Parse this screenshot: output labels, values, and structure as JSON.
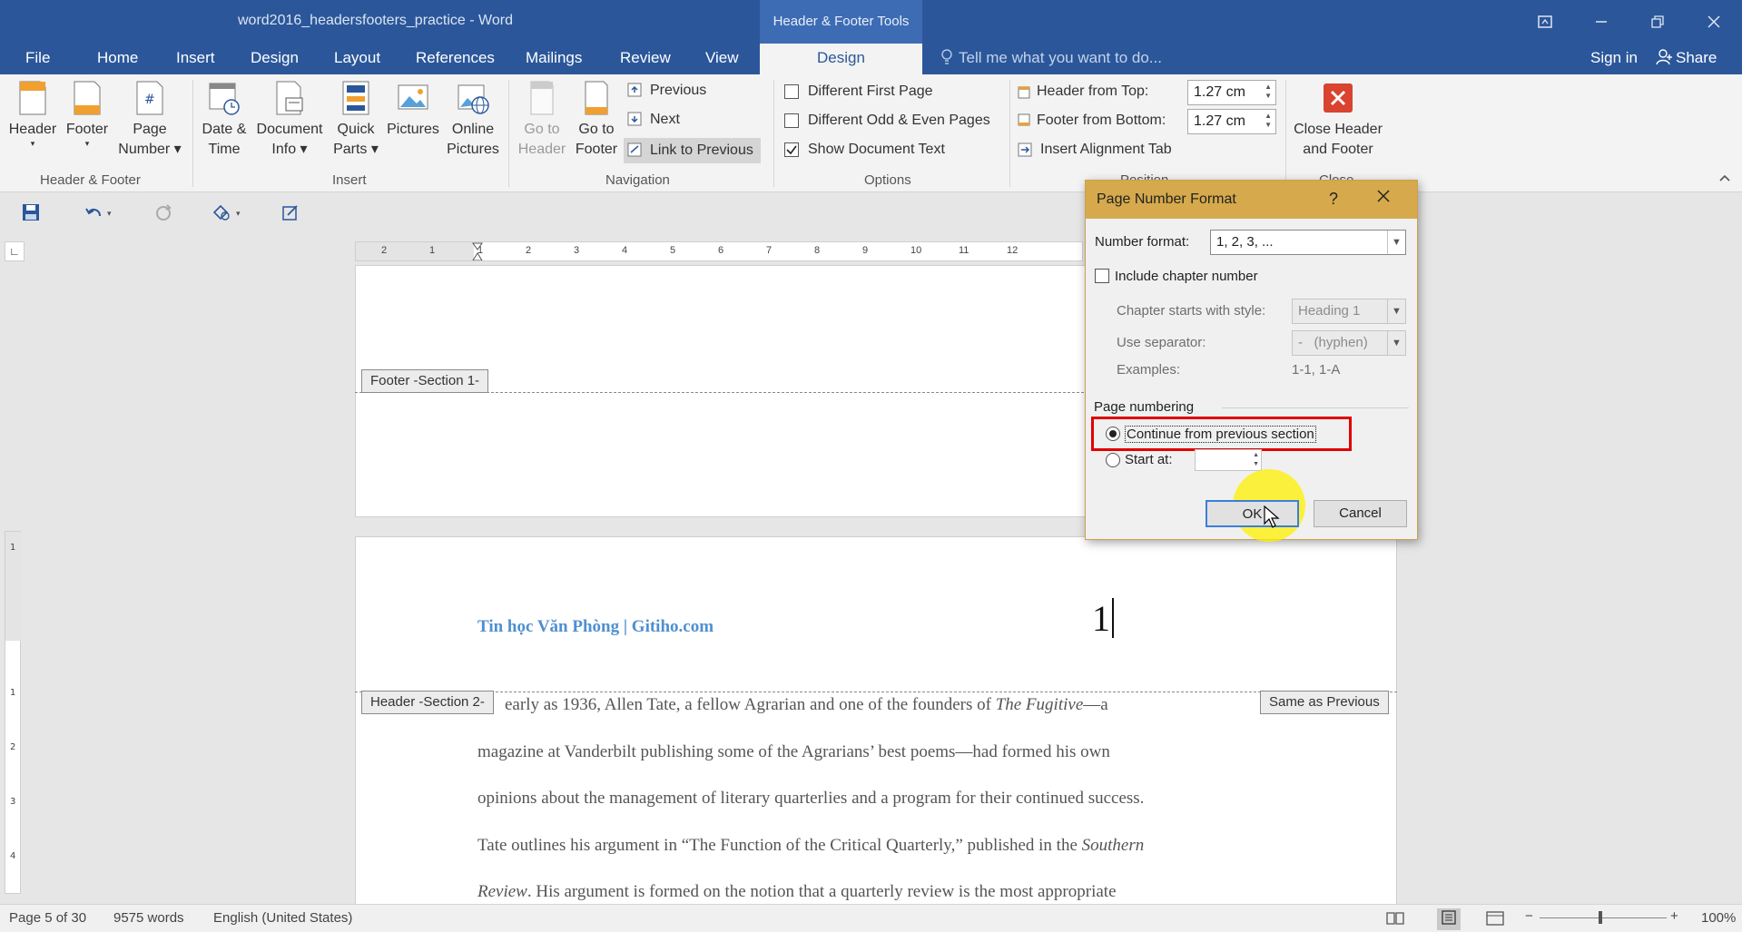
{
  "titlebar": {
    "doc_title": "word2016_headersfooters_practice - Word",
    "tools_context": "Header & Footer Tools"
  },
  "tabs": {
    "file": "File",
    "home": "Home",
    "insert": "Insert",
    "design": "Design",
    "layout": "Layout",
    "references": "References",
    "mailings": "Mailings",
    "review": "Review",
    "view": "View",
    "design_active": "Design",
    "tellme": "Tell me what you want to do...",
    "signin": "Sign in",
    "share": "Share"
  },
  "ribbon": {
    "header_btn": "Header",
    "footer_btn": "Footer",
    "page_number_l1": "Page",
    "page_number_l2": "Number",
    "group_header_footer": "Header & Footer",
    "date_time_l1": "Date &",
    "date_time_l2": "Time",
    "doc_info_l1": "Document",
    "doc_info_l2": "Info",
    "quick_parts_l1": "Quick",
    "quick_parts_l2": "Parts",
    "pictures": "Pictures",
    "online_pictures_l1": "Online",
    "online_pictures_l2": "Pictures",
    "group_insert": "Insert",
    "goto_header_l1": "Go to",
    "goto_header_l2": "Header",
    "goto_footer_l1": "Go to",
    "goto_footer_l2": "Footer",
    "previous": "Previous",
    "next": "Next",
    "link_to_previous": "Link to Previous",
    "group_navigation": "Navigation",
    "diff_first_page": "Different First Page",
    "diff_odd_even": "Different Odd & Even Pages",
    "show_doc_text": "Show Document Text",
    "group_options": "Options",
    "header_from_top": "Header from Top:",
    "footer_from_bottom": "Footer from Bottom:",
    "header_from_top_val": "1.27 cm",
    "footer_from_bottom_val": "1.27 cm",
    "insert_alignment_tab": "Insert Alignment Tab",
    "group_position": "Position",
    "close_l1": "Close Header",
    "close_l2": "and Footer",
    "group_close": "Close"
  },
  "ruler": {
    "ticks": [
      "2",
      "1",
      "1",
      "2",
      "3",
      "4",
      "5",
      "6",
      "7",
      "8",
      "9",
      "10",
      "11",
      "12"
    ]
  },
  "document": {
    "footer_tag": "Footer -Section 1-",
    "header_tag": "Header -Section 2-",
    "same_as_previous": "Same as Previous",
    "header_brand": "Tin học Văn Phòng | Gitiho.com",
    "page_num": "1",
    "line1a": "early as 1936, Allen Tate, a fellow Agrarian and one of the founders of ",
    "line1b": "The Fugitive",
    "line1c": "—a",
    "line2": "magazine at Vanderbilt publishing some of the Agrarians’ best poems—had formed his own",
    "line3": "opinions about the management of literary quarterlies and a program for their continued success.",
    "line4a": "Tate outlines his argument in “The Function of the Critical Quarterly,” published in the ",
    "line4b": "Southern",
    "line5a": "Review",
    "line5b": ". His argument is formed on the notion that a quarterly review is the most appropriate"
  },
  "dialog": {
    "title": "Page Number Format",
    "help": "?",
    "number_format_label": "Number format:",
    "number_format_value": "1, 2, 3, ...",
    "include_chapter": "Include chapter number",
    "chapter_style_label": "Chapter starts with style:",
    "chapter_style_value": "Heading 1",
    "separator_label": "Use separator:",
    "separator_value": "-   (hyphen)",
    "examples_label": "Examples:",
    "examples_value": "1-1, 1-A",
    "page_numbering_label": "Page numbering",
    "continue_label": "Continue from previous section",
    "start_at_label": "Start at:",
    "ok": "OK",
    "cancel": "Cancel",
    "highlight_color": "#e00000"
  },
  "statusbar": {
    "page": "Page 5 of 30",
    "words": "9575 words",
    "language": "English (United States)",
    "zoom": "100%"
  }
}
